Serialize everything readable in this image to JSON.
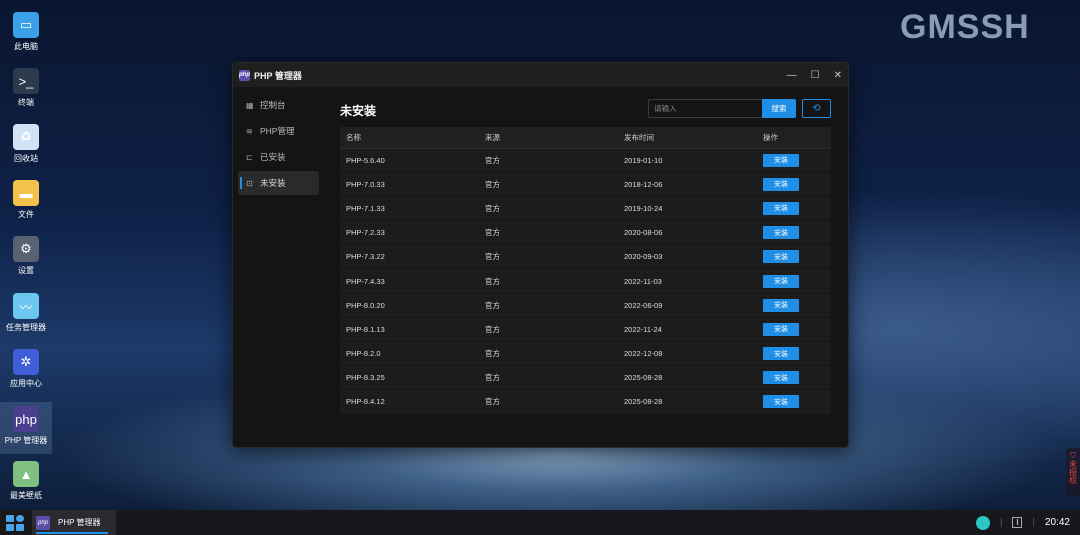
{
  "brand": "GMSSH",
  "desktop": [
    {
      "label": "此电脑",
      "icon": "computer-icon"
    },
    {
      "label": "终端",
      "icon": "terminal-icon"
    },
    {
      "label": "回收站",
      "icon": "recycle-bin-icon"
    },
    {
      "label": "文件",
      "icon": "folder-icon"
    },
    {
      "label": "设置",
      "icon": "gear-icon"
    },
    {
      "label": "任务管理器",
      "icon": "task-manager-icon"
    },
    {
      "label": "应用中心",
      "icon": "app-center-icon"
    },
    {
      "label": "PHP 管理器",
      "icon": "php-icon"
    },
    {
      "label": "最美壁纸",
      "icon": "wallpaper-icon"
    }
  ],
  "window": {
    "title": "PHP 管理器",
    "logo": "php",
    "sidebar": [
      {
        "label": "控制台"
      },
      {
        "label": "PHP管理"
      },
      {
        "label": "已安装"
      },
      {
        "label": "未安装"
      }
    ],
    "page_title": "未安装",
    "search": {
      "placeholder": "请输入",
      "button": "搜索"
    },
    "table": {
      "headers": [
        "名称",
        "来源",
        "发布时间",
        "操作"
      ],
      "rows": [
        {
          "name": "PHP-5.6.40",
          "source": "官方",
          "date": "2019-01-10",
          "action": "安装"
        },
        {
          "name": "PHP-7.0.33",
          "source": "官方",
          "date": "2018-12-06",
          "action": "安装"
        },
        {
          "name": "PHP-7.1.33",
          "source": "官方",
          "date": "2019-10-24",
          "action": "安装"
        },
        {
          "name": "PHP-7.2.33",
          "source": "官方",
          "date": "2020-08-06",
          "action": "安装"
        },
        {
          "name": "PHP-7.3.22",
          "source": "官方",
          "date": "2020-09-03",
          "action": "安装"
        },
        {
          "name": "PHP-7.4.33",
          "source": "官方",
          "date": "2022-11-03",
          "action": "安装"
        },
        {
          "name": "PHP-8.0.20",
          "source": "官方",
          "date": "2022-06-09",
          "action": "安装"
        },
        {
          "name": "PHP-8.1.13",
          "source": "官方",
          "date": "2022-11-24",
          "action": "安装"
        },
        {
          "name": "PHP-8.2.0",
          "source": "官方",
          "date": "2022-12-08",
          "action": "安装"
        },
        {
          "name": "PHP-8.3.25",
          "source": "官方",
          "date": "2025-08-28",
          "action": "安装"
        },
        {
          "name": "PHP-8.4.12",
          "source": "官方",
          "date": "2025-08-28",
          "action": "安装"
        }
      ]
    }
  },
  "authorization": "未授权",
  "taskbar": {
    "app": "PHP 管理器",
    "time": "20:42"
  }
}
